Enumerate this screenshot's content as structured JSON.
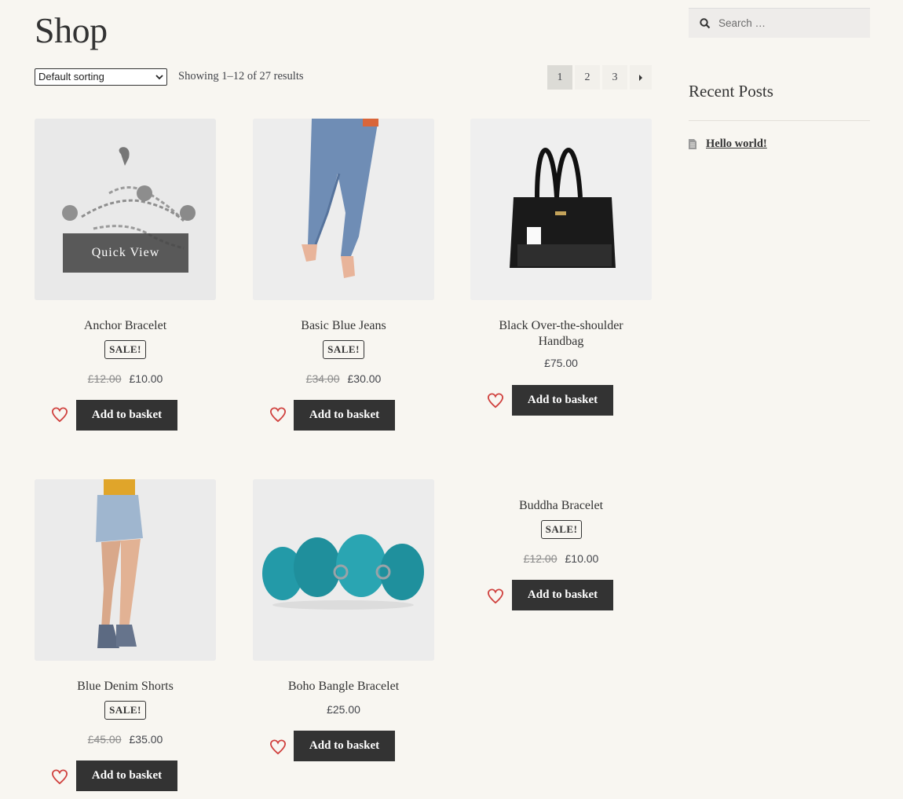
{
  "page": {
    "title": "Shop"
  },
  "toolbar": {
    "sorting_selected": "Default sorting",
    "result_count": "Showing 1–12 of 27 results",
    "pages": [
      "1",
      "2",
      "3"
    ],
    "next_icon": "next-arrow-icon"
  },
  "products": [
    {
      "title": "Anchor Bracelet",
      "sale": "SALE!",
      "old_price": "£12.00",
      "price": "£10.00",
      "button": "Add to basket",
      "quick_view": "Quick View"
    },
    {
      "title": "Basic Blue Jeans",
      "sale": "SALE!",
      "old_price": "£34.00",
      "price": "£30.00",
      "button": "Add to basket"
    },
    {
      "title_line1": "Black Over-the-shoulder",
      "title_line2": "Handbag",
      "price": "£75.00",
      "button": "Add to basket"
    },
    {
      "title": "Blue Denim Shorts",
      "sale": "SALE!",
      "old_price": "£45.00",
      "price": "£35.00",
      "button": "Add to basket"
    },
    {
      "title": "Boho Bangle Bracelet",
      "price": "£25.00",
      "button": "Add to basket"
    },
    {
      "title": "Buddha Bracelet",
      "sale": "SALE!",
      "old_price": "£12.00",
      "price": "£10.00",
      "button": "Add to basket"
    }
  ],
  "sidebar": {
    "search_placeholder": "Search …",
    "recent_posts_title": "Recent Posts",
    "posts": [
      {
        "label": "Hello world!"
      }
    ]
  },
  "colors": {
    "background": "#f8f6f1",
    "button": "#333333",
    "heart": "#d0413e",
    "text": "#43454b"
  }
}
